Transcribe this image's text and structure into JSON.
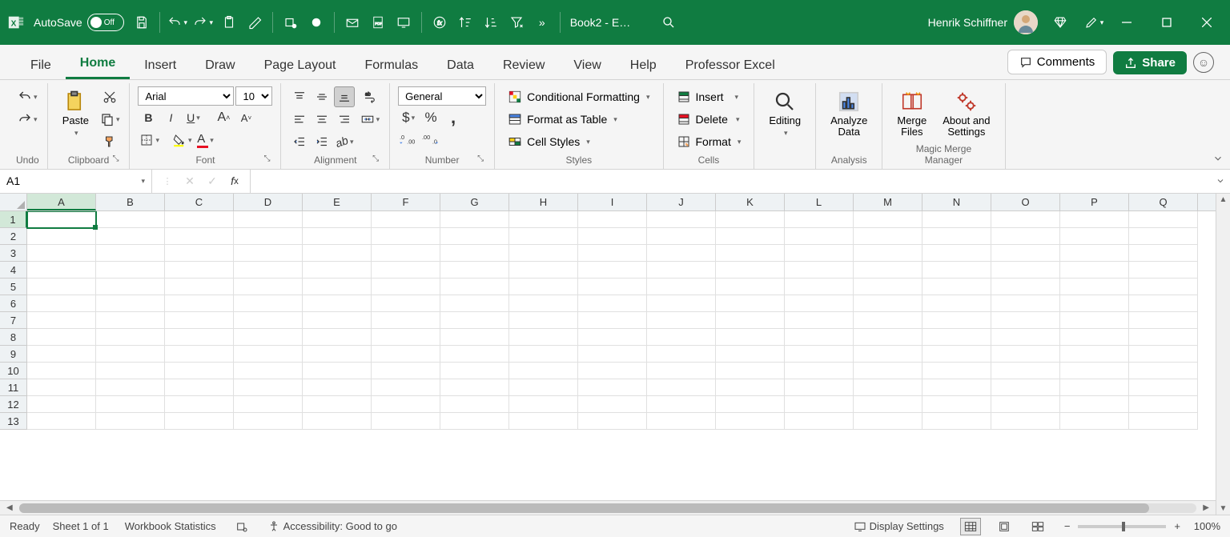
{
  "titlebar": {
    "autosave_label": "AutoSave",
    "autosave_state": "Off",
    "doc_title": "Book2  -  E…",
    "user_name": "Henrik Schiffner"
  },
  "tabs": {
    "items": [
      "File",
      "Home",
      "Insert",
      "Draw",
      "Page Layout",
      "Formulas",
      "Data",
      "Review",
      "View",
      "Help",
      "Professor Excel"
    ],
    "active": "Home",
    "comments": "Comments",
    "share": "Share"
  },
  "ribbon": {
    "undo": {
      "label": "Undo"
    },
    "clipboard": {
      "label": "Clipboard",
      "paste": "Paste"
    },
    "font": {
      "label": "Font",
      "name": "Arial",
      "size": "10"
    },
    "alignment": {
      "label": "Alignment"
    },
    "number": {
      "label": "Number",
      "format": "General"
    },
    "styles": {
      "label": "Styles",
      "conditional": "Conditional Formatting",
      "table": "Format as Table",
      "cell": "Cell Styles"
    },
    "cells": {
      "label": "Cells",
      "insert": "Insert",
      "delete": "Delete",
      "format": "Format"
    },
    "editing": {
      "label": "Editing"
    },
    "analysis": {
      "label": "Analysis",
      "analyze": "Analyze Data"
    },
    "merge": {
      "label": "Magic Merge Manager",
      "merge_files": "Merge Files",
      "about": "About and Settings"
    }
  },
  "formula_bar": {
    "cell_ref": "A1",
    "formula": ""
  },
  "grid": {
    "columns": [
      "A",
      "B",
      "C",
      "D",
      "E",
      "F",
      "G",
      "H",
      "I",
      "J",
      "K",
      "L",
      "M",
      "N",
      "O",
      "P",
      "Q"
    ],
    "rows": [
      1,
      2,
      3,
      4,
      5,
      6,
      7,
      8,
      9,
      10,
      11,
      12,
      13
    ],
    "selected_col": "A",
    "selected_row": 1
  },
  "status": {
    "ready": "Ready",
    "sheet": "Sheet 1 of 1",
    "stats": "Workbook Statistics",
    "accessibility": "Accessibility: Good to go",
    "display": "Display Settings",
    "zoom": "100%"
  }
}
